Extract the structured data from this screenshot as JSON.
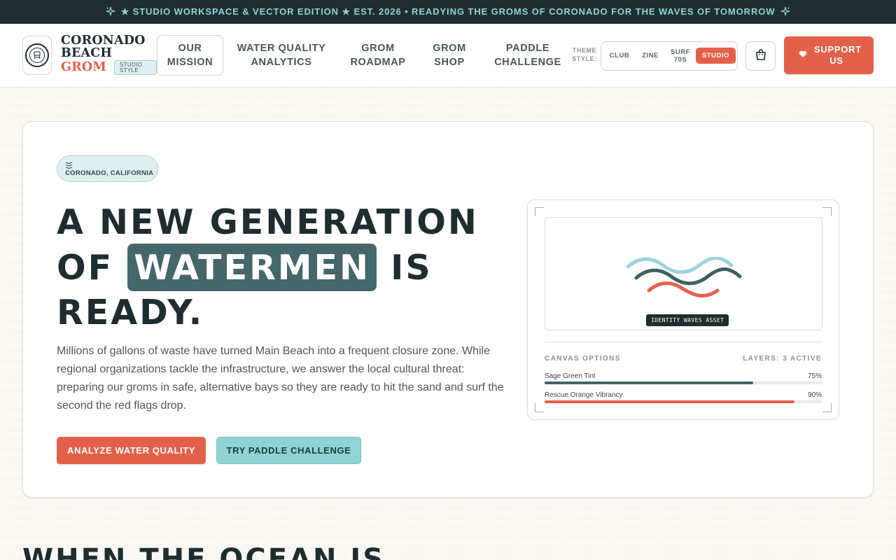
{
  "banner": {
    "text": "★ STUDIO WORKSPACE & VECTOR EDITION ★ EST. 2026 • READYING THE GROMS OF CORONADO FOR THE WAVES OF TOMORROW",
    "icon": "sparkle-icon"
  },
  "brand": {
    "line1": "CORONADO",
    "line2": "BEACH",
    "line3": "GROM",
    "tag": "STUDIO STYLE",
    "logo_icon": "lifeguard-tower-icon"
  },
  "nav": {
    "items": [
      {
        "label": "OUR MISSION",
        "active": true
      },
      {
        "label": "WATER QUALITY ANALYTICS",
        "active": false
      },
      {
        "label": "GROM ROADMAP",
        "active": false
      },
      {
        "label": "GROM SHOP",
        "active": false
      },
      {
        "label": "PADDLE CHALLENGE",
        "active": false
      }
    ]
  },
  "theme": {
    "label": "THEME STYLE:",
    "options": [
      "CLUB",
      "ZINE",
      "SURF 70S",
      "STUDIO"
    ],
    "selected": "STUDIO"
  },
  "cart": {
    "icon": "cart-icon"
  },
  "support": {
    "label": "SUPPORT US",
    "icon": "heart-icon"
  },
  "hero": {
    "location": "CORONADO, CALIFORNIA",
    "location_icon": "waves-icon",
    "headline_part1": "A NEW GENERATION OF",
    "headline_highlight": "WATERMEN",
    "headline_part2": "IS READY.",
    "description": "Millions of gallons of waste have turned Main Beach into a frequent closure zone. While regional organizations tackle the infrastructure, we answer the local cultural threat: preparing our groms in safe, alternative bays so they are ready to hit the sand and surf the second the red flags drop.",
    "cta_primary": "ANALYZE WATER QUALITY",
    "cta_secondary": "TRY PADDLE CHALLENGE"
  },
  "canvas": {
    "asset_label": "IDENTITY WAVES ASSET",
    "options_title": "CANVAS OPTIONS",
    "layers_label": "LAYERS: 3 ACTIVE",
    "sliders": [
      {
        "label": "Sage Green Tint",
        "value_text": "75%",
        "value": 0.75,
        "color": "#45666a"
      },
      {
        "label": "Rescue Orange Vibrancy",
        "value_text": "90%",
        "value": 0.9,
        "color": "#e3614a"
      }
    ],
    "wave_colors": [
      "#9dd3dc",
      "#3f5f63",
      "#e3614a"
    ]
  },
  "next_section": {
    "heading": "WHEN THE OCEAN IS"
  },
  "colors": {
    "accent_orange": "#e3614a",
    "teal_dark": "#45666a",
    "aqua": "#8fd3d6",
    "ink": "#1e2d30"
  }
}
